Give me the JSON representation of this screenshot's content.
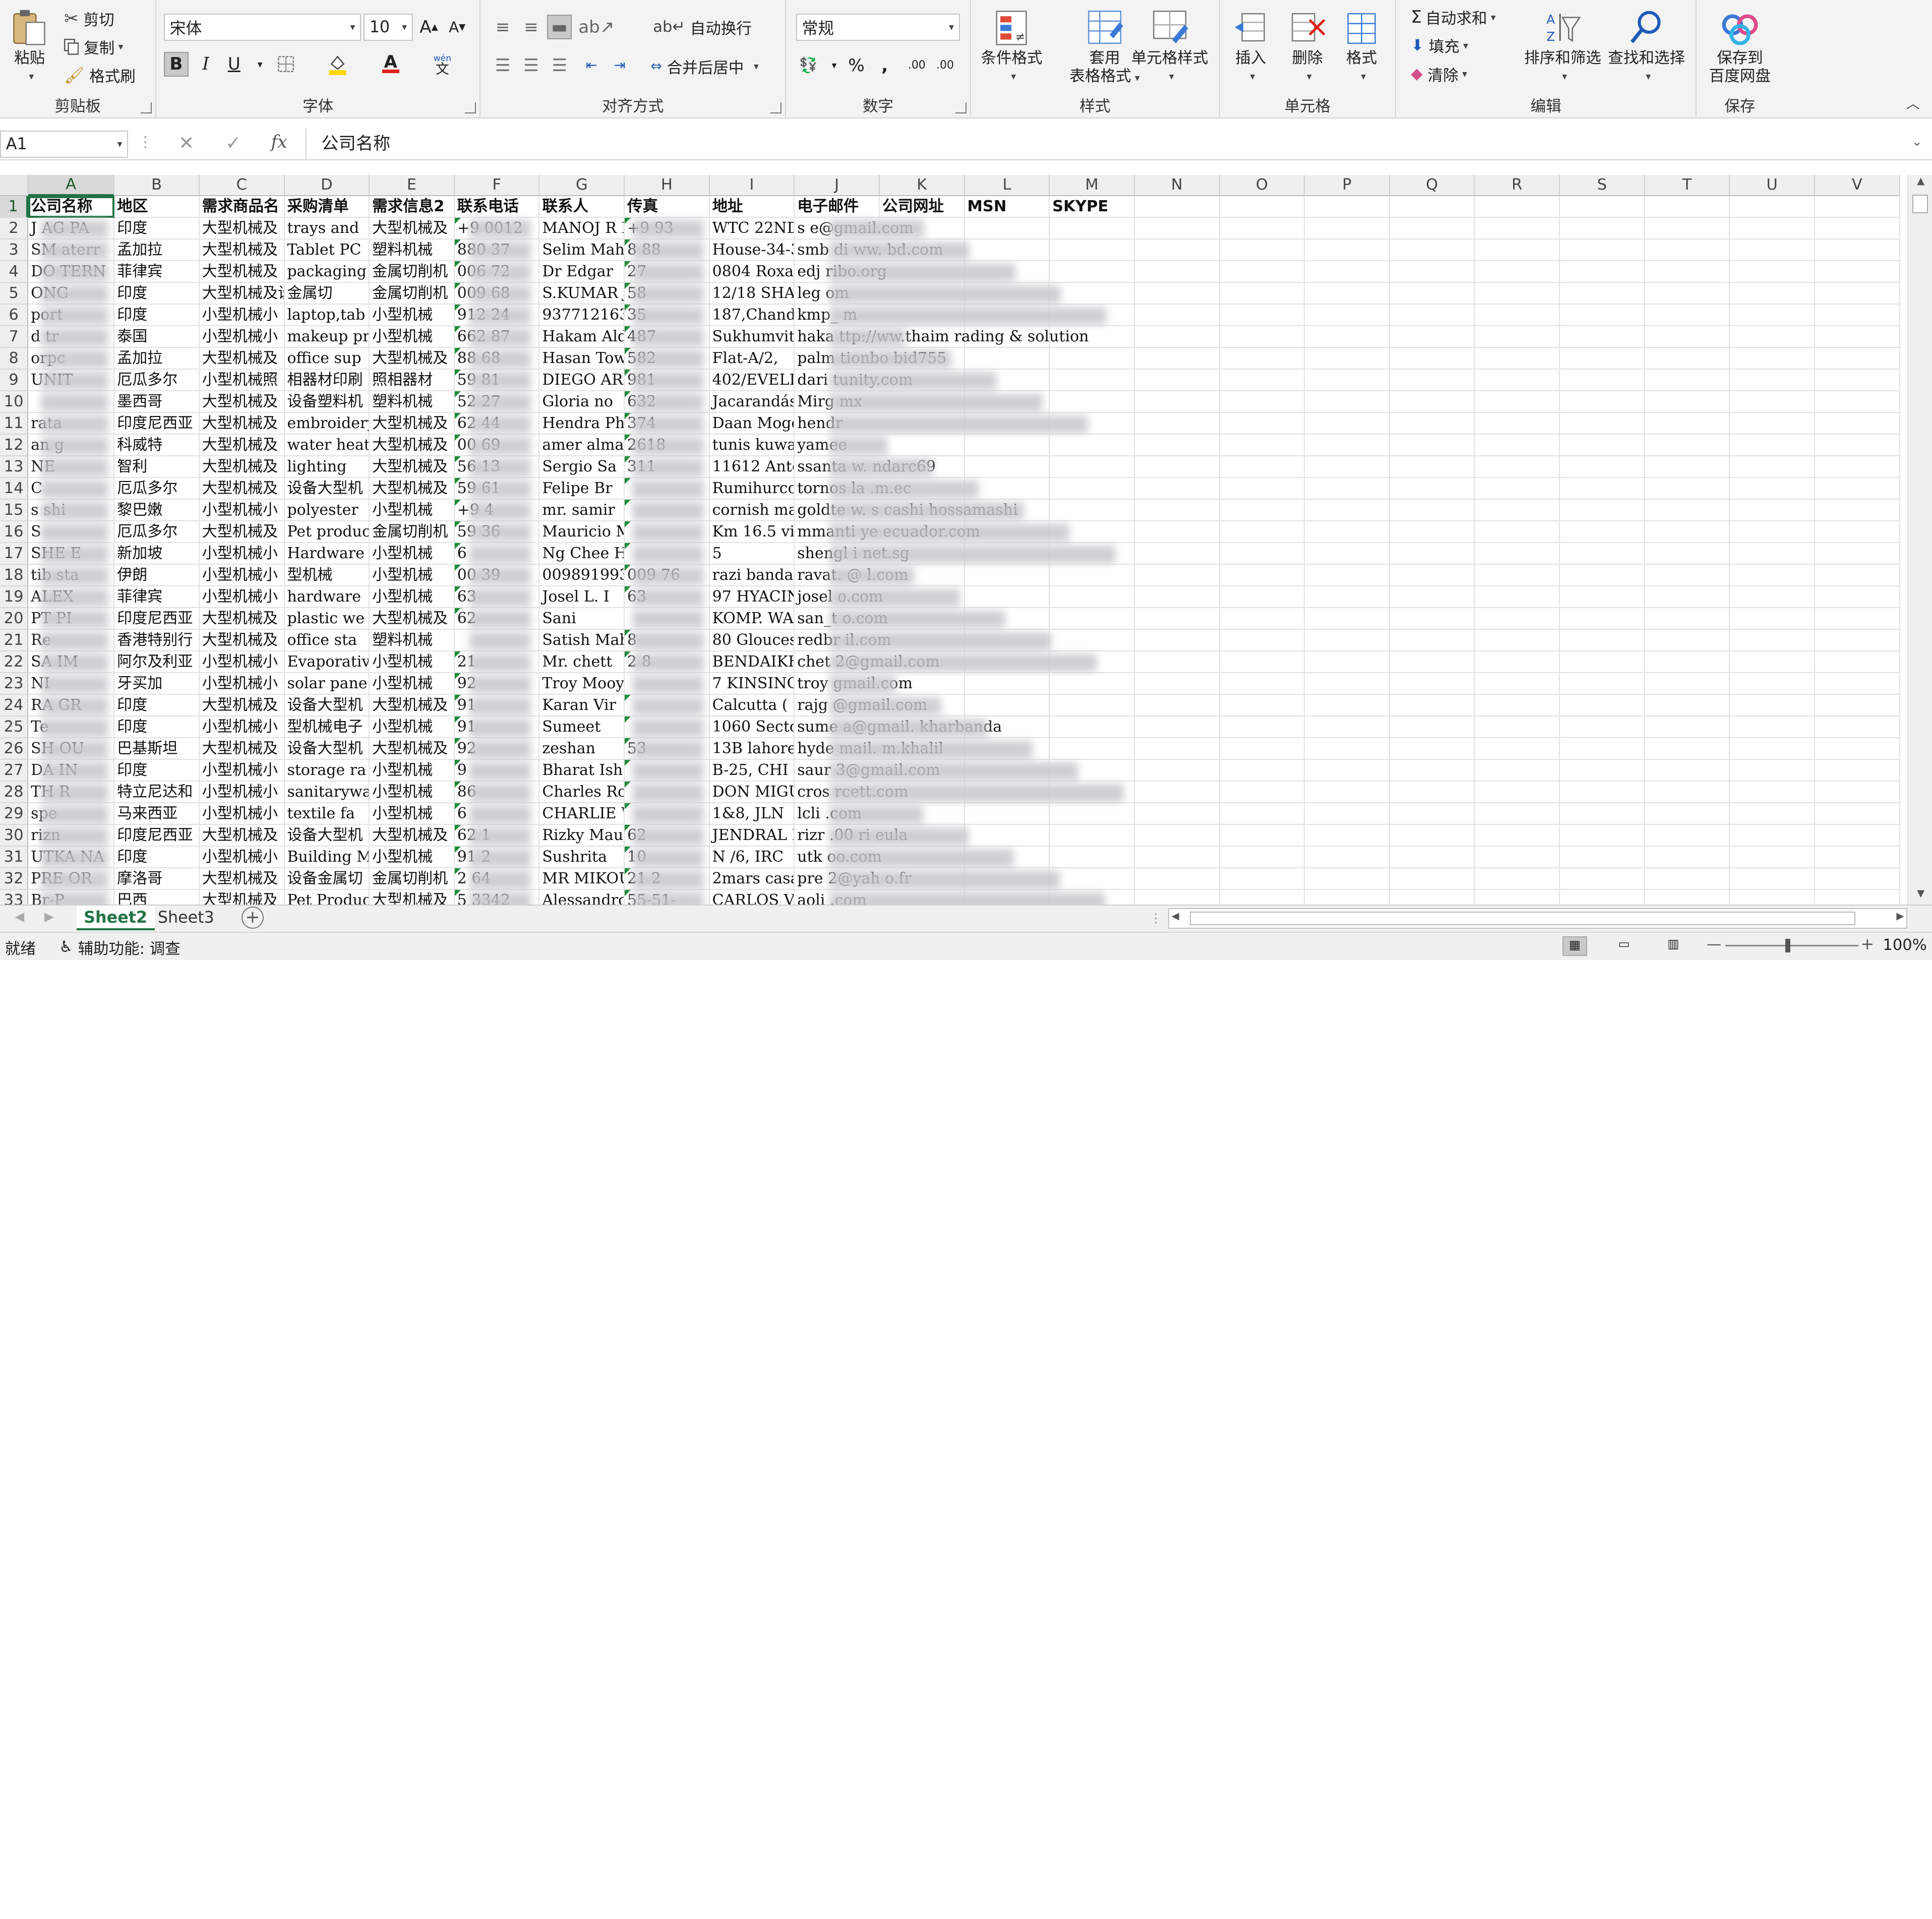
{
  "clipboard": {
    "group_label": "剪贴板",
    "paste": "粘贴",
    "cut": "剪切",
    "copy": "复制",
    "format_painter": "格式刷"
  },
  "font": {
    "group_label": "字体",
    "font_name": "宋体",
    "font_size": "10",
    "bold": "B",
    "italic": "I",
    "underline": "U",
    "increase": "A",
    "decrease": "A",
    "wen": "wén",
    "wen_char": "文"
  },
  "alignment": {
    "group_label": "对齐方式",
    "wrap": "自动换行",
    "merge": "合并后居中"
  },
  "number": {
    "group_label": "数字",
    "format": "常规",
    "percent": "%",
    "comma": ",",
    "inc_decimal": ".00",
    "dec_decimal": ".00"
  },
  "styles": {
    "group_label": "样式",
    "conditional": "条件格式",
    "table1": "套用",
    "table2": "表格格式",
    "cell_styles": "单元格样式"
  },
  "cells": {
    "group_label": "单元格",
    "insert": "插入",
    "delete": "删除",
    "format": "格式"
  },
  "editing": {
    "group_label": "编辑",
    "autosum": "自动求和",
    "fill": "填充",
    "clear": "清除",
    "sort": "排序和筛选",
    "find": "查找和选择"
  },
  "save": {
    "group_label": "保存",
    "btn1": "保存到",
    "btn2": "百度网盘"
  },
  "formula_bar": {
    "name_box": "A1",
    "fx": "fx",
    "content": "公司名称",
    "cancel": "✕",
    "enter": "✓"
  },
  "columns": [
    "A",
    "B",
    "C",
    "D",
    "E",
    "F",
    "G",
    "H",
    "I",
    "J",
    "K",
    "L",
    "M",
    "N",
    "O",
    "P",
    "Q",
    "R",
    "S",
    "T",
    "U",
    "V"
  ],
  "header_row": [
    "公司名称",
    "地区",
    "需求商品名",
    "采购清单",
    "需求信息2",
    "联系电话",
    "联系人",
    "传真",
    "地址",
    "电子邮件",
    "公司网址",
    "MSN",
    "SKYPE"
  ],
  "rows": [
    {
      "n": "2",
      "a": "J      AG  PA",
      "b": "印度",
      "c": "大型机械及",
      "d": "trays and",
      "e": "大型机械及",
      "f": "+9       0012",
      "g": "MANOJ R ME",
      "h": "+9      93",
      "i": "WTC 22ND F",
      "j": "s         e@gmail.com",
      "k": "",
      "l": "",
      "m": ""
    },
    {
      "n": "3",
      "a": "SM   aterr",
      "b": "孟加拉",
      "c": "大型机械及",
      "d": "Tablet PC",
      "e": "塑料机械",
      "f": "880       37",
      "g": "Selim Mah",
      "h": "8      88",
      "i": "House-34-3",
      "j": "smb    di      ww.      bd.com",
      "k": "",
      "l": "",
      "m": ""
    },
    {
      "n": "4",
      "a": "DO   TERN",
      "b": "菲律宾",
      "c": "大型机械及",
      "d": "packaging",
      "e": "金属切削机",
      "f": "006       72",
      "g": "Dr Edgar",
      "h": "      27",
      "i": "0804 Roxas",
      "j": "edj                        ribo.org",
      "k": "",
      "l": "",
      "m": ""
    },
    {
      "n": "5",
      "a": "    ONG",
      "b": "印度",
      "c": "大型机械及设备",
      "d": "金属切",
      "e": "金属切削机",
      "f": "009       68",
      "g": "S.KUMAR J",
      "h": "       58",
      "i": "12/18 SHAF",
      "j": "leg                       om",
      "k": "",
      "l": "",
      "m": ""
    },
    {
      "n": "6",
      "a": "      port",
      "b": "印度",
      "c": "小型机械小",
      "d": "laptop,tab",
      "e": "小型机械",
      "f": "912       24",
      "g": "9377121638",
      "h": "       35",
      "i": "187,Chandi",
      "j": "kmp_                      m",
      "k": "",
      "l": "",
      "m": ""
    },
    {
      "n": "7",
      "a": "      d tr",
      "b": "泰国",
      "c": "小型机械小",
      "d": "makeup pro",
      "e": "小型机械",
      "f": "662       87",
      "g": "Hakam Ald",
      "h": "       487",
      "i": "Sukhumvit",
      "j": "haka      ttp://ww.thaim           rading & solution",
      "k": "",
      "l": "",
      "m": ""
    },
    {
      "n": "8",
      "a": "      orpc",
      "b": "孟加拉",
      "c": "大型机械及",
      "d": "office sup",
      "e": "大型机械及",
      "f": "88       68",
      "g": "Hasan Tow",
      "h": "       582",
      "i": "Flat-A/2,",
      "j": "palm      tionbo                         bid755",
      "k": "",
      "l": "",
      "m": ""
    },
    {
      "n": "9",
      "a": "     UNIT",
      "b": "厄瓜多尔",
      "c": "小型机械照",
      "d": "相器材印刷",
      "e": "照相器材",
      "f": "59       81",
      "g": "DIEGO ARI",
      "h": "      981",
      "i": "402/EVELIZ",
      "j": "dari           tunity.com",
      "k": "",
      "l": "",
      "m": ""
    },
    {
      "n": "10",
      "a": "",
      "b": "墨西哥",
      "c": "大型机械及",
      "d": "设备塑料机",
      "e": "塑料机械",
      "f": "52       27",
      "g": "Gloria no",
      "h": "      632",
      "i": "Jacarandás",
      "j": "Mirg                     mx",
      "k": "",
      "l": "",
      "m": ""
    },
    {
      "n": "11",
      "a": "      rata",
      "b": "印度尼西亚",
      "c": "大型机械及",
      "d": "embroidery",
      "e": "大型机械及",
      "f": "62       44",
      "g": "Hendra Phe",
      "h": "      374",
      "i": "Daan Mogot",
      "j": "hendr",
      "k": "",
      "l": "",
      "m": ""
    },
    {
      "n": "12",
      "a": "      an g",
      "b": "科威特",
      "c": "大型机械及",
      "d": "water heat",
      "e": "大型机械及",
      "f": "00       69",
      "g": "amer alma",
      "h": "      2618",
      "i": "tunis kuwa",
      "j": "yamee",
      "k": "",
      "l": "",
      "m": ""
    },
    {
      "n": "13",
      "a": "      NE",
      "b": "智利",
      "c": "大型机械及",
      "d": "lighting",
      "e": "大型机械及",
      "f": "56       13",
      "g": "Sergio Sa",
      "h": "      311",
      "i": "11612 Anto",
      "j": "ssanta      w.                        ndarc69",
      "k": "",
      "l": "",
      "m": ""
    },
    {
      "n": "14",
      "a": "       C",
      "b": "厄瓜多尔",
      "c": "大型机械及",
      "d": "设备大型机",
      "e": "大型机械及",
      "f": "59       61",
      "g": "Felipe Br",
      "h": "      ",
      "i": "Rumihurco",
      "j": "tornos          la   .m.ec",
      "k": "",
      "l": "",
      "m": ""
    },
    {
      "n": "15",
      "a": "s     shi",
      "b": "黎巴嫩",
      "c": "小型机械小",
      "d": "polyester",
      "e": "小型机械",
      "f": "+9       4",
      "g": "mr. samir",
      "h": "      ",
      "i": "cornish ma",
      "j": "goldte      w. s   cashi    hossamashi",
      "k": "",
      "l": "",
      "m": ""
    },
    {
      "n": "16",
      "a": "S",
      "b": "厄瓜多尔",
      "c": "大型机械及",
      "d": "Pet produc",
      "e": "金属切削机",
      "f": "59       36",
      "g": "Mauricio M",
      "h": "      ",
      "i": "Km 16.5 vi",
      "j": "mmanti       ye  ecuador.com",
      "k": "",
      "l": "",
      "m": ""
    },
    {
      "n": "17",
      "a": "SHE     E",
      "b": "新加坡",
      "c": "小型机械小",
      "d": "Hardware",
      "e": "小型机械",
      "f": "6       ",
      "g": "Ng Chee He",
      "h": "      ",
      "i": "5",
      "j": "shengl          i  net.sg",
      "k": "",
      "l": "",
      "m": ""
    },
    {
      "n": "18",
      "a": "tib   sta",
      "b": "伊朗",
      "c": "小型机械小",
      "d": "型机械",
      "e": "小型机械",
      "f": "00       39",
      "g": "0098919939",
      "h": "009     76",
      "i": "razi banda",
      "j": "ravat.       @    l.com",
      "k": "",
      "l": "",
      "m": ""
    },
    {
      "n": "19",
      "a": "ALEX",
      "b": "菲律宾",
      "c": "小型机械小",
      "d": "hardware",
      "e": "小型机械",
      "f": "63       ",
      "g": "Josel L. I",
      "h": "63      ",
      "i": "97 HYACIN",
      "j": "josel            o.com",
      "k": "",
      "l": "",
      "m": ""
    },
    {
      "n": "20",
      "a": "PT      PI",
      "b": "印度尼西亚",
      "c": "大型机械及",
      "d": "plastic we",
      "e": "大型机械及",
      "f": "62       ",
      "g": "Sani",
      "h": "",
      "i": "KOMP. WALA",
      "j": "san_t           o.com",
      "k": "",
      "l": "",
      "m": ""
    },
    {
      "n": "21",
      "a": "Re",
      "b": "香港特别行",
      "c": "大型机械及",
      "d": "office sta",
      "e": "塑料机械",
      "f": "",
      "g": "Satish Mah",
      "h": "8      ",
      "i": "80 Glouces",
      "j": "redbr             il.com",
      "k": "",
      "l": "",
      "m": ""
    },
    {
      "n": "22",
      "a": "SA      IM",
      "b": "阿尔及利亚",
      "c": "小型机械小",
      "d": "Evaporativ",
      "e": "小型机械",
      "f": "21       ",
      "g": "Mr. chett",
      "h": "2      8",
      "i": "BENDAIKHA",
      "j": "chet            2@gmail.com",
      "k": "",
      "l": "",
      "m": ""
    },
    {
      "n": "23",
      "a": "NI",
      "b": "牙买加",
      "c": "小型机械小",
      "d": "solar pane",
      "e": "小型机械",
      "f": "92       ",
      "g": "Troy Mooyo",
      "h": "",
      "i": "7 KINSING",
      "j": "troy            gmail.com",
      "k": "",
      "l": "",
      "m": ""
    },
    {
      "n": "24",
      "a": "RA      GR",
      "b": "印度",
      "c": "大型机械及",
      "d": "设备大型机",
      "e": "大型机械及",
      "f": "91       ",
      "g": "Karan Vir",
      "h": "      ",
      "i": "Calcutta (",
      "j": "rajg            @gmail.com",
      "k": "",
      "l": "",
      "m": ""
    },
    {
      "n": "25",
      "a": "Te",
      "b": "印度",
      "c": "小型机械小",
      "d": "型机械电子",
      "e": "小型机械",
      "f": "91       ",
      "g": "Sumeet",
      "h": "      ",
      "i": "1060 Secto",
      "j": "sume          a@gmail.           kharbanda",
      "k": "",
      "l": "",
      "m": ""
    },
    {
      "n": "26",
      "a": "SH      OU",
      "b": "巴基斯坦",
      "c": "大型机械及",
      "d": "设备大型机",
      "e": "大型机械及",
      "f": "92       ",
      "g": "zeshan",
      "h": "      53",
      "i": "13B lahore",
      "j": "hyde          mail.          m.khalil",
      "k": "",
      "l": "",
      "m": ""
    },
    {
      "n": "27",
      "a": "DA      IN",
      "b": "印度",
      "c": "小型机械小",
      "d": "storage ra",
      "e": "小型机械",
      "f": "9       ",
      "g": "Bharat Ish",
      "h": "      ",
      "i": "B-25, CHI",
      "j": "saur           3@gmail.com",
      "k": "",
      "l": "",
      "m": ""
    },
    {
      "n": "28",
      "a": "TH      R",
      "b": "特立尼达和",
      "c": "小型机械小",
      "d": "sanitarywa",
      "e": "小型机械",
      "f": "86       ",
      "g": "Charles Ro",
      "h": "      ",
      "i": "DON MIGUEL",
      "j": "cros           rcett.com",
      "k": "",
      "l": "",
      "m": ""
    },
    {
      "n": "29",
      "a": "spe      ",
      "b": "马来西亚",
      "c": "小型机械小",
      "d": "textile fa",
      "e": "小型机械",
      "f": "6       ",
      "g": "CHARLIE W",
      "h": "      ",
      "i": "1&8, JLN",
      "j": "lcli           .com",
      "k": "",
      "l": "",
      "m": ""
    },
    {
      "n": "30",
      "a": "rizn",
      "b": "印度尼西亚",
      "c": "大型机械及",
      "d": "设备大型机",
      "e": "大型机械及",
      "f": "62       1",
      "g": "Rizky Mau",
      "h": "62      ",
      "i": "JENDRAL B",
      "j": "rizr          .00   ri          eula",
      "k": "",
      "l": "",
      "m": ""
    },
    {
      "n": "31",
      "a": "UTKA      NA",
      "b": "印度",
      "c": "小型机械小",
      "d": "Building M",
      "e": "小型机械",
      "f": "91       2",
      "g": "Sushrita",
      "h": "10      ",
      "i": "N /6, IRC",
      "j": "utk           oo.com",
      "k": "",
      "l": "",
      "m": ""
    },
    {
      "n": "32",
      "a": "PRE      OR",
      "b": "摩洛哥",
      "c": "大型机械及",
      "d": "设备金属切",
      "e": "金属切削机",
      "f": "2       64",
      "g": "MR MIKOU",
      "h": "21      2",
      "i": "2mars casa",
      "j": "pre          2@yah               o.fr",
      "k": "",
      "l": "",
      "m": ""
    },
    {
      "n": "33",
      "a": "Br-P",
      "b": "巴西",
      "c": "大型机械及",
      "d": "Pet Produc",
      "e": "大型机械及",
      "f": "5       3342",
      "g": "Alessandro",
      "h": "55-51-",
      "i": "CARLOS VO",
      "j": "aoli           .com",
      "k": "",
      "l": "",
      "m": ""
    }
  ],
  "sheet_tabs": [
    "Sheet2",
    "Sheet3"
  ],
  "status": {
    "ready": "就绪",
    "accessibility": "辅助功能: 调查",
    "zoom": "100%",
    "minus": "—",
    "plus": "+"
  }
}
